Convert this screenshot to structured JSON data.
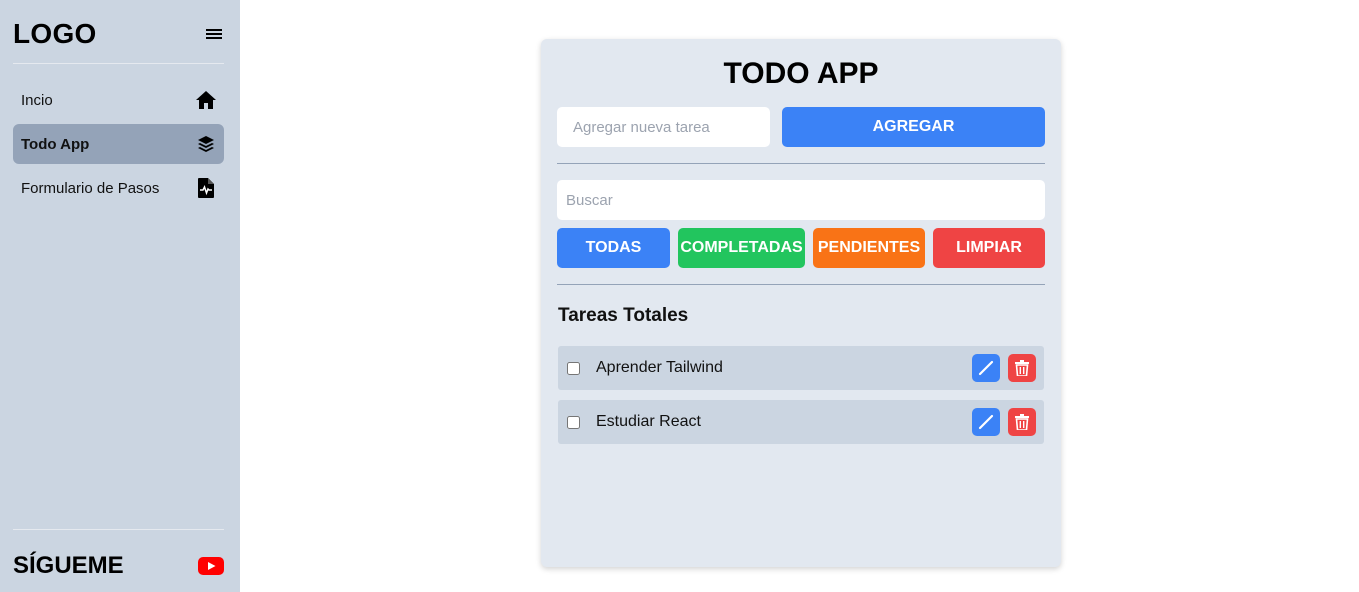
{
  "sidebar": {
    "logo": "LOGO",
    "items": [
      {
        "label": "Incio",
        "icon": "home-icon",
        "active": false
      },
      {
        "label": "Todo App",
        "icon": "layers-icon",
        "active": true
      },
      {
        "label": "Formulario de Pasos",
        "icon": "file-pulse-icon",
        "active": false
      }
    ],
    "follow_label": "SÍGUEME",
    "follow_icon": "youtube-icon"
  },
  "todo": {
    "title": "TODO APP",
    "new_task_placeholder": "Agregar nueva tarea",
    "add_label": "AGREGAR",
    "search_placeholder": "Buscar",
    "filters": {
      "all": "TODAS",
      "completed": "COMPLETADAS",
      "pending": "PENDIENTES",
      "clear": "LIMPIAR"
    },
    "section_title": "Tareas Totales",
    "tasks": [
      {
        "text": "Aprender Tailwind",
        "done": false
      },
      {
        "text": "Estudiar React",
        "done": false
      }
    ]
  },
  "colors": {
    "sidebar_bg": "#cbd5e1",
    "active_item": "#94a3b8",
    "card_bg": "#e2e8f0",
    "blue": "#3b82f6",
    "green": "#22c55e",
    "orange": "#f97316",
    "red": "#ef4444",
    "youtube": "#ff0000"
  }
}
